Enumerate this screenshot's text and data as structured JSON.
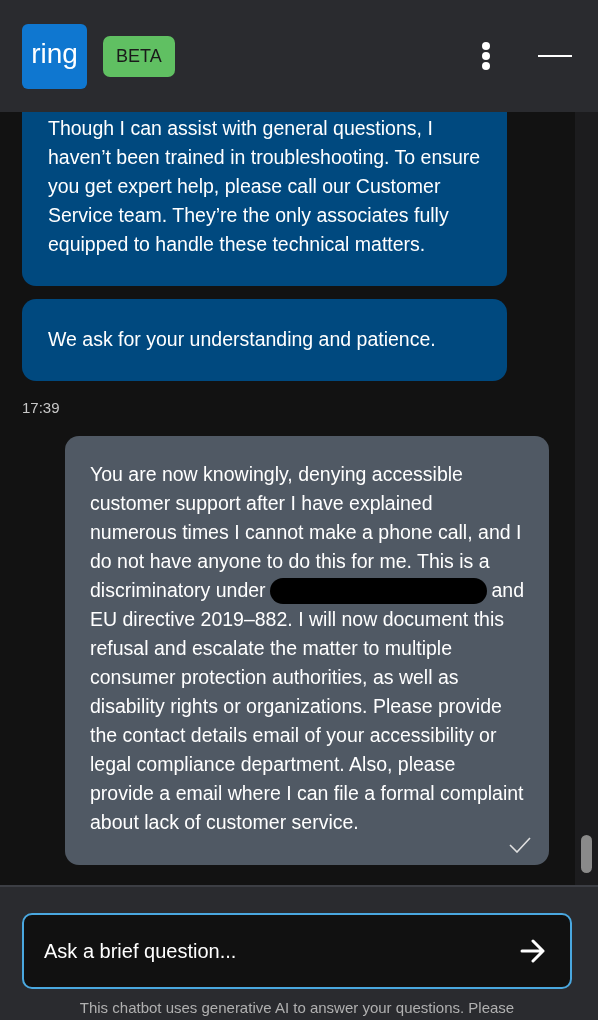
{
  "header": {
    "logo": "ring",
    "badge": "BETA"
  },
  "messages": [
    {
      "kind": "bot",
      "segments": [
        {
          "kind": "text",
          "text": "Though I can assist with general questions, I haven’t been trained in troubleshooting. To ensure you get expert help, please call our Customer Service team. They’re the only associates fully equipped to handle these technical matters."
        }
      ]
    },
    {
      "kind": "bot",
      "segments": [
        {
          "kind": "text",
          "text": "We ask for your understanding and patience."
        }
      ]
    },
    {
      "kind": "time",
      "text": "17:39"
    },
    {
      "kind": "user",
      "delivered": true,
      "segments": [
        {
          "kind": "text",
          "text": "You are now knowingly, denying accessible customer support after I have explained numerous times I cannot make a phone call, and I do not have anyone to do this for me. This is a"
        },
        {
          "kind": "redacted_line",
          "before": "discriminatory under",
          "after": "and"
        },
        {
          "kind": "text",
          "text": "EU directive 2019–882. I will now document this refusal and escalate the matter to multiple consumer protection authorities, as well as disability rights or organizations. Please provide the contact details email of your accessibility or legal compliance department. Also, please provide a email where I can file a formal complaint about lack of customer service."
        }
      ]
    }
  ],
  "composer": {
    "placeholder": "Ask a brief question..."
  },
  "disclaimer": "This chatbot uses generative AI to answer your questions. Please"
}
